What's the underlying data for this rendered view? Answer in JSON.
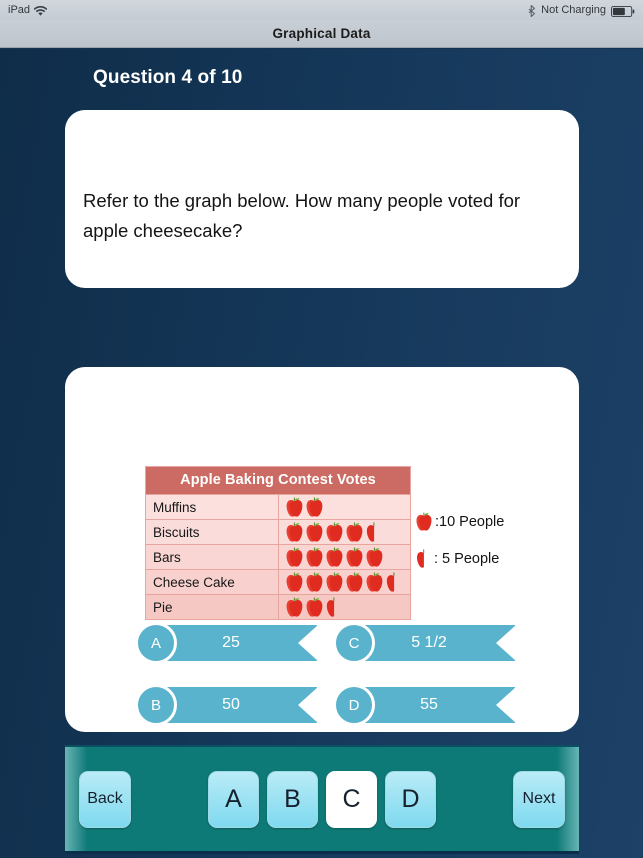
{
  "status_bar": {
    "device_label": "iPad",
    "wifi_icon": "wifi-icon",
    "bluetooth_icon": "bluetooth-icon",
    "charging_status": "Not Charging",
    "battery_icon": "battery-icon",
    "battery_level_percent": 65
  },
  "nav": {
    "title": "Graphical Data"
  },
  "quiz": {
    "counter": "Question 4 of 10",
    "question_number": 4,
    "question_total": 10,
    "question_text": "Refer to the graph below. How many people voted for apple cheesecake?",
    "selected_answer": "C"
  },
  "chart_data": {
    "type": "pictograph",
    "title": "Apple Baking Contest Votes",
    "categories": [
      "Muffins",
      "Biscuits",
      "Bars",
      "Cheese Cake",
      "Pie"
    ],
    "values": [
      20,
      45,
      50,
      55,
      25
    ],
    "icons": [
      {
        "full": 2,
        "half": 0
      },
      {
        "full": 4,
        "half": 1
      },
      {
        "full": 5,
        "half": 0
      },
      {
        "full": 5,
        "half": 1
      },
      {
        "full": 2,
        "half": 1
      }
    ],
    "icon_unit_value": 10,
    "half_icon_unit_value": 5,
    "legend": [
      {
        "icon": "apple-icon-full",
        "text": ":10 People"
      },
      {
        "icon": "apple-icon-half",
        "text": ": 5 People"
      }
    ],
    "xlabel": "",
    "ylabel": "",
    "grid": false,
    "legend_position": "right"
  },
  "answers": [
    {
      "letter": "A",
      "text": "25"
    },
    {
      "letter": "B",
      "text": "50"
    },
    {
      "letter": "C",
      "text": "5  1/2"
    },
    {
      "letter": "D",
      "text": "55"
    }
  ],
  "toolbar": {
    "back_label": "Back",
    "next_label": "Next",
    "choices": [
      "A",
      "B",
      "C",
      "D"
    ],
    "selected_choice": "C"
  },
  "colors": {
    "background_navy": "#14324f",
    "card_white": "#ffffff",
    "table_header_red": "#cc6b63",
    "banner_teal": "#5ab3cd",
    "toolbar_teal": "#0e7a77",
    "button_cyan": "#7fd9ef",
    "apple_red": "#e02b21"
  }
}
